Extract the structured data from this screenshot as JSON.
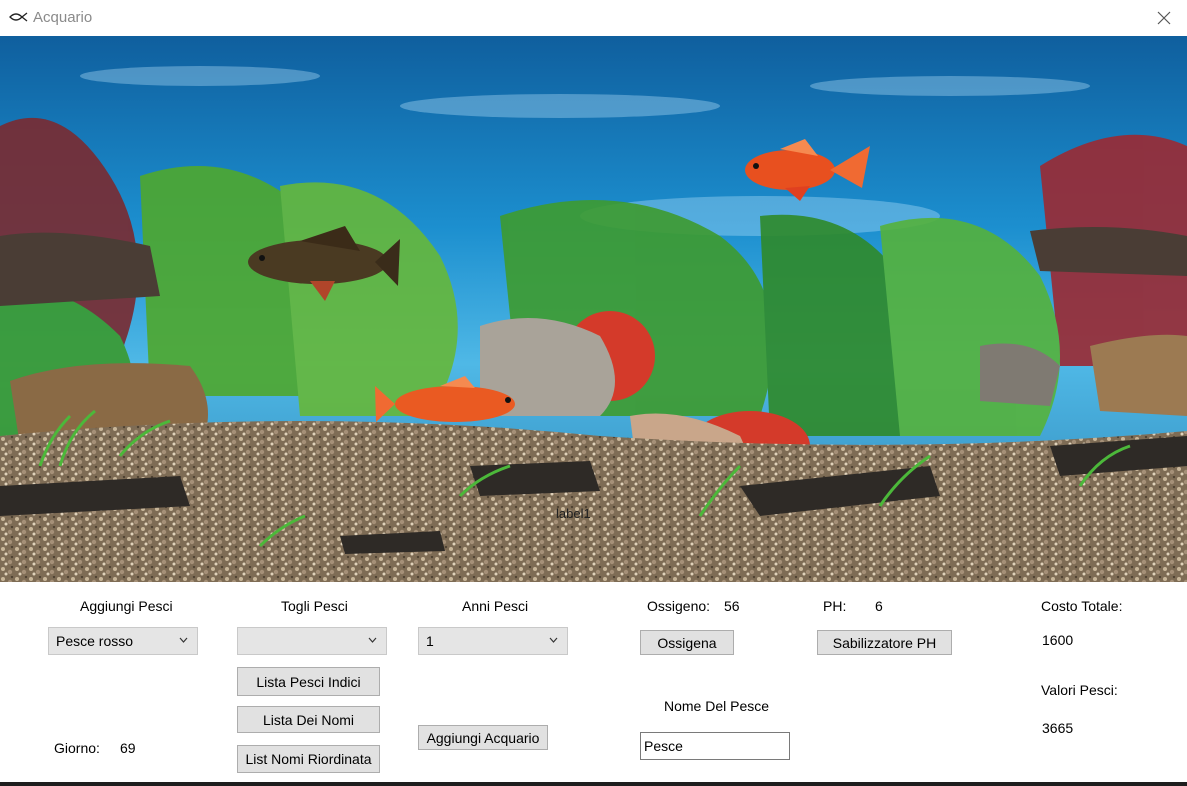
{
  "window": {
    "title": "Acquario",
    "app_icon": "fish-icon",
    "close_icon": "close-icon"
  },
  "aquarium": {
    "label": "label1"
  },
  "controls": {
    "aggiungi_pesci": {
      "label": "Aggiungi Pesci",
      "selected": "Pesce rosso"
    },
    "togli_pesci": {
      "label": "Togli Pesci",
      "selected": ""
    },
    "anni_pesci": {
      "label": "Anni Pesci",
      "selected": "1"
    },
    "ossigeno": {
      "label": "Ossigeno:",
      "value": "56",
      "button": "Ossigena"
    },
    "ph": {
      "label": "PH:",
      "value": "6",
      "button": "Sabilizzatore PH"
    },
    "costo": {
      "label": "Costo Totale:",
      "value": "1600"
    },
    "valori": {
      "label": "Valori Pesci:",
      "value": "3665"
    },
    "buttons": {
      "lista_indici": "Lista Pesci Indici",
      "lista_nomi": "Lista Dei Nomi",
      "lista_riordinata": "List Nomi Riordinata",
      "aggiungi_acquario": "Aggiungi Acquario"
    },
    "nome": {
      "label": "Nome Del Pesce",
      "value": "Pesce"
    },
    "giorno": {
      "label": "Giorno:",
      "value": "69"
    }
  }
}
